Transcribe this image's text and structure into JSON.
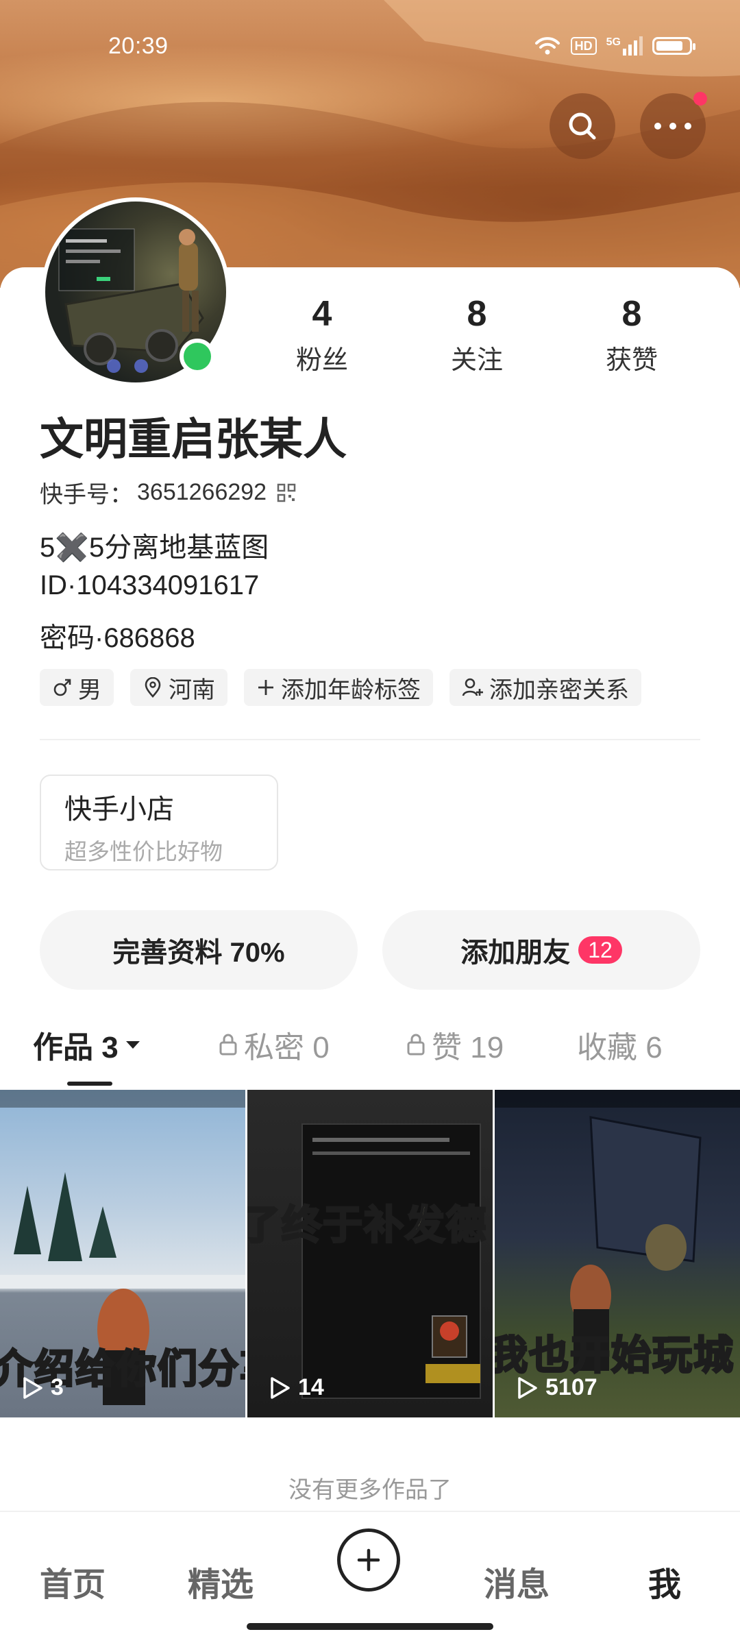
{
  "status_bar": {
    "time": "20:39",
    "hd": "HD",
    "network": "5G"
  },
  "profile": {
    "name": "文明重启张某人",
    "kuaishou_id_label": "快手号：",
    "kuaishou_id": "3651266292",
    "bio_lines": [
      "5✖️5分离地基蓝图",
      "ID·104334091617",
      "密码·686868"
    ],
    "stats": [
      {
        "num": "4",
        "label": "粉丝"
      },
      {
        "num": "8",
        "label": "关注"
      },
      {
        "num": "8",
        "label": "获赞"
      }
    ],
    "tags": [
      {
        "icon": "male-icon",
        "text": "男"
      },
      {
        "icon": "location-icon",
        "text": "河南"
      },
      {
        "icon": "plus-icon",
        "text": "添加年龄标签"
      },
      {
        "icon": "person-add-icon",
        "text": "添加亲密关系"
      }
    ]
  },
  "shop": {
    "title": "快手小店",
    "subtitle": "超多性价比好物"
  },
  "actions": {
    "complete_profile": "完善资料 70%",
    "add_friends": "添加朋友",
    "add_friends_badge": "12"
  },
  "tabs": [
    {
      "label": "作品 3",
      "active": true
    },
    {
      "label": "私密 0",
      "locked": true
    },
    {
      "label": "赞 19",
      "locked": true
    },
    {
      "label": "收藏 6"
    }
  ],
  "works": [
    {
      "caption": "介绍给你们分享一个",
      "plays": "3"
    },
    {
      "caption": "了终于补发德",
      "plays": "14"
    },
    {
      "caption": "我也开始玩城",
      "plays": "5107"
    }
  ],
  "footer_note": "没有更多作品了",
  "bottom_nav": [
    {
      "label": "首页"
    },
    {
      "label": "精选"
    },
    {
      "label": "消息"
    },
    {
      "label": "我",
      "active": true
    }
  ],
  "colors": {
    "accent": "#fe3666",
    "online": "#2fc75d"
  }
}
